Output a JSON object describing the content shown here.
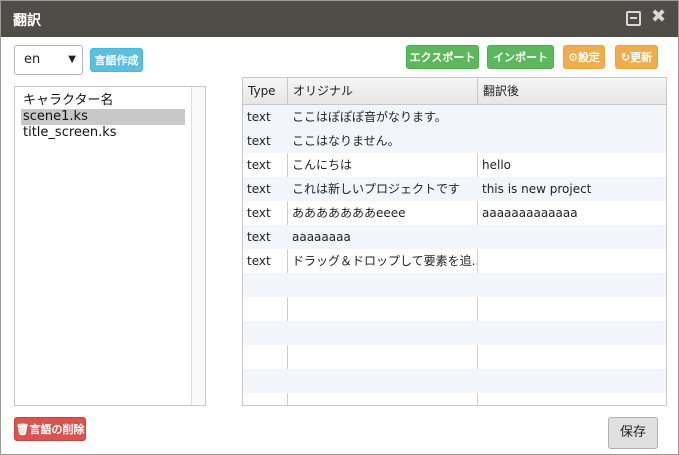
{
  "dialog": {
    "title": "翻訳"
  },
  "language": {
    "selected": "en"
  },
  "buttons": {
    "create_language": "言語作成",
    "export": "エクスポート",
    "import": "インポート",
    "settings": "設定",
    "refresh": "更新",
    "delete_language": "言語の削除",
    "save": "保存"
  },
  "files": [
    "キャラクター名",
    "scene1.ks",
    "title_screen.ks"
  ],
  "selected_file": "scene1.ks",
  "table": {
    "headers": [
      "Type",
      "オリジナル",
      "翻訳後"
    ],
    "rows": [
      [
        "text",
        "ここはぽぽぽ音がなります。",
        ""
      ],
      [
        "text",
        "ここはなりません。",
        ""
      ],
      [
        "text",
        "こんにちは",
        "hello"
      ],
      [
        "text",
        "これは新しいプロジェクトです",
        "this is new project"
      ],
      [
        "text",
        "あああああああeeee",
        "aaaaaaaaaaaaa"
      ],
      [
        "text",
        "aaaaaaaa",
        ""
      ],
      [
        "text",
        "ドラッグ＆ドロップして要素を追...",
        ""
      ]
    ]
  },
  "icons": {
    "minimize": "minimize-icon",
    "close": "close-icon",
    "settings": "gear-icon",
    "refresh": "refresh-icon",
    "delete": "trash-icon",
    "dropdown": "chevron-down-icon"
  },
  "colors": {
    "titlebar": "#4e4d48",
    "blue": "#5bc0de",
    "green": "#5cb85c",
    "orange": "#f0ad4e",
    "red": "#d9534f"
  }
}
